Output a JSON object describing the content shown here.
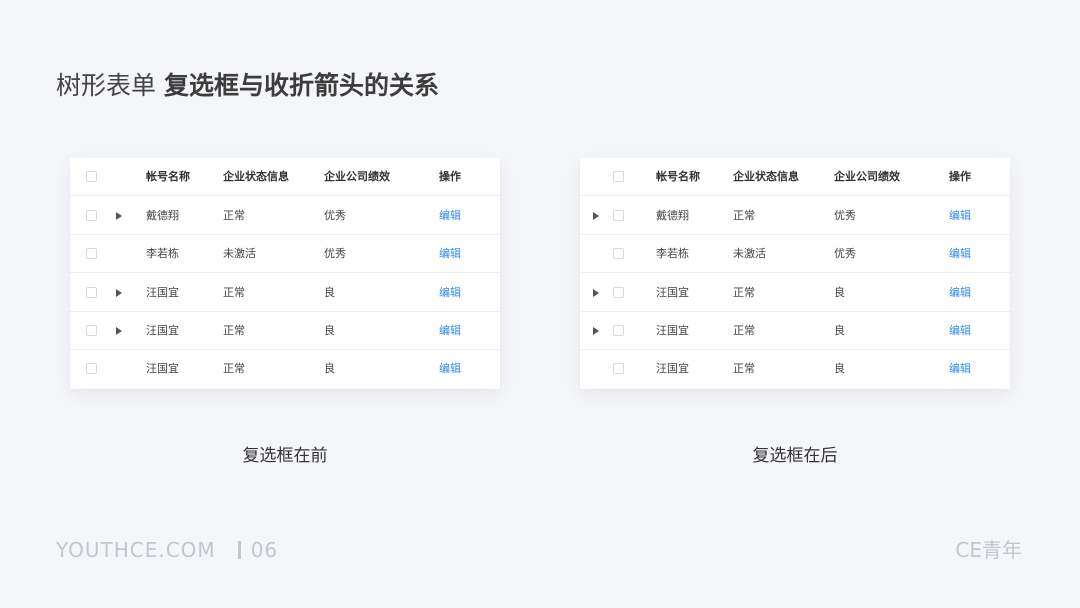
{
  "title": {
    "light": "树形表单",
    "bold": "复选框与收折箭头的关系"
  },
  "table": {
    "headers": {
      "account": "帐号名称",
      "status": "企业状态信息",
      "performance": "企业公司绩效",
      "action": "操作"
    },
    "rows": [
      {
        "name": "戴德翔",
        "status": "正常",
        "performance": "优秀",
        "action": "编辑",
        "expandable": true
      },
      {
        "name": "李若栋",
        "status": "未激活",
        "performance": "优秀",
        "action": "编辑",
        "expandable": false
      },
      {
        "name": "汪国宜",
        "status": "正常",
        "performance": "良",
        "action": "编辑",
        "expandable": true
      },
      {
        "name": "汪国宜",
        "status": "正常",
        "performance": "良",
        "action": "编辑",
        "expandable": true
      },
      {
        "name": "汪国宜",
        "status": "正常",
        "performance": "良",
        "action": "编辑",
        "expandable": false
      }
    ]
  },
  "captions": {
    "left": "复选框在前",
    "right": "复选框在后"
  },
  "footer": {
    "site": "YOUTHCE.COM",
    "page": "06",
    "brand": "CE青年"
  },
  "colors": {
    "link": "#2d8cf0",
    "background": "#f5f6f9",
    "icon": "expand-arrow-icon"
  }
}
